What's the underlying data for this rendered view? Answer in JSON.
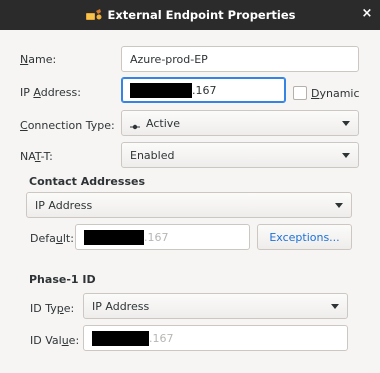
{
  "window": {
    "title": "External Endpoint Properties",
    "close_glyph": "×"
  },
  "form": {
    "name_label": "Name:",
    "name_value": "Azure-prod-EP",
    "ip_label": "IP Address:",
    "ip_value_suffix": ".167",
    "dynamic_label": "Dynamic",
    "dynamic_checked": false,
    "connection_type_label": "Connection Type:",
    "connection_type_value": "Active",
    "connection_type_icon": "connection-active-icon",
    "natt_label": "NAT-T:",
    "natt_value": "Enabled"
  },
  "contact": {
    "section_title": "Contact Addresses",
    "mode_value": "IP Address",
    "default_label": "Default:",
    "default_value_suffix": ".167",
    "exceptions_button": "Exceptions..."
  },
  "phase1": {
    "section_title": "Phase-1 ID",
    "id_type_label": "ID Type:",
    "id_type_value": "IP Address",
    "id_value_label": "ID Value:",
    "id_value_suffix": ".167"
  },
  "colors": {
    "titlebar_bg": "#2b2b2b",
    "focus_accent": "#3584e4",
    "link_blue": "#1c71d8"
  }
}
